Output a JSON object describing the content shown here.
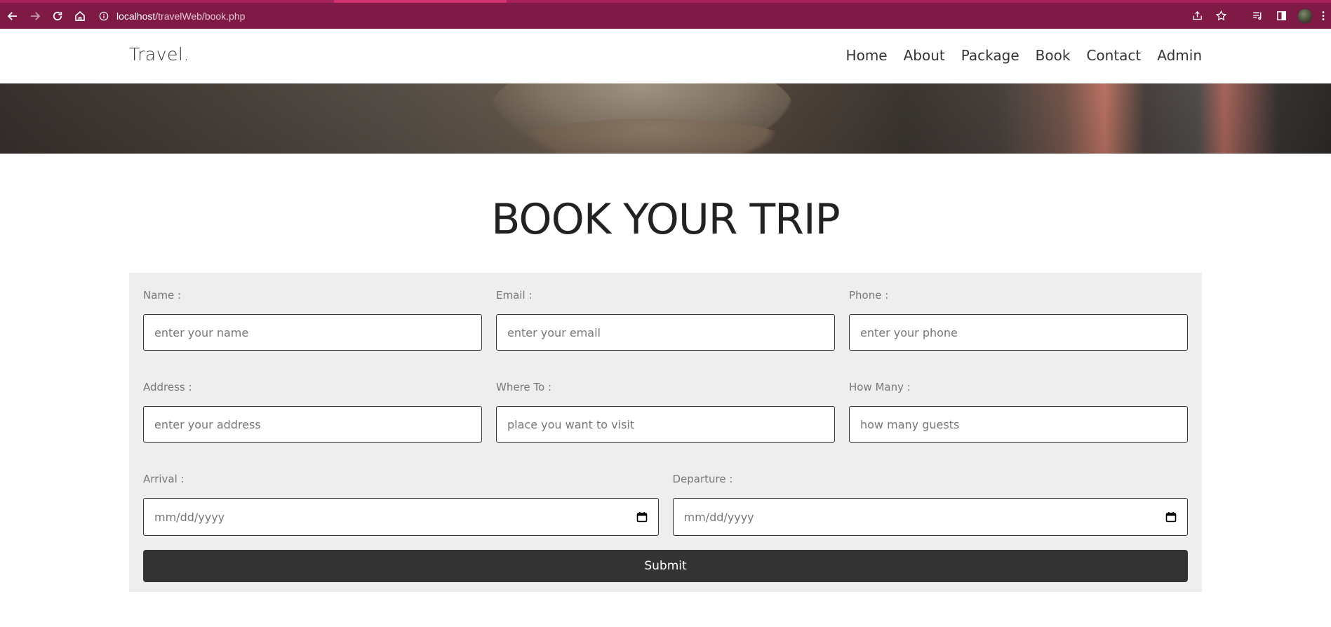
{
  "browser": {
    "url_host": "localhost",
    "url_path": "/travelWeb/book.php",
    "accent": "#7f1a47"
  },
  "site": {
    "logo": "Travel.",
    "nav": [
      "Home",
      "About",
      "Package",
      "Book",
      "Contact",
      "Admin"
    ]
  },
  "page": {
    "title": "BOOK YOUR TRIP"
  },
  "form": {
    "name": {
      "label": "Name :",
      "placeholder": "enter your name"
    },
    "email": {
      "label": "Email :",
      "placeholder": "enter your email"
    },
    "phone": {
      "label": "Phone :",
      "placeholder": "enter your phone"
    },
    "address": {
      "label": "Address :",
      "placeholder": "enter your address"
    },
    "where_to": {
      "label": "Where To :",
      "placeholder": "place you want to visit"
    },
    "how_many": {
      "label": "How Many :",
      "placeholder": "how many guests"
    },
    "arrival": {
      "label": "Arrival :",
      "placeholder": "mm/dd/yyyy"
    },
    "departure": {
      "label": "Departure :",
      "placeholder": "mm/dd/yyyy"
    },
    "submit_label": "Submit"
  }
}
